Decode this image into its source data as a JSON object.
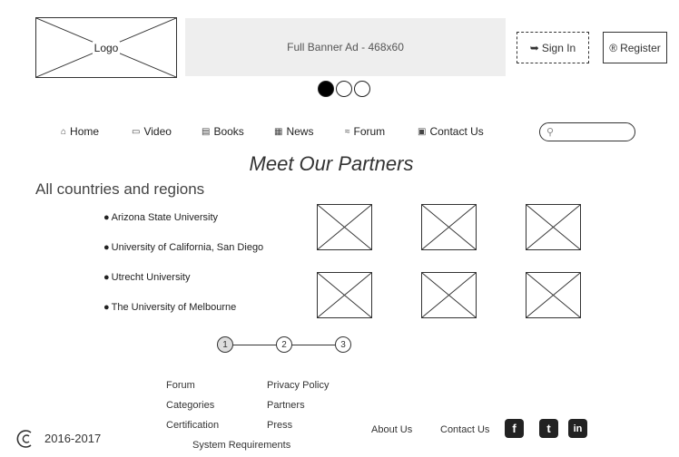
{
  "header": {
    "logo_label": "Logo",
    "banner_text": "Full Banner Ad - 468x60",
    "signin_label": "Sign In",
    "register_label": "Register"
  },
  "carousel": {
    "active_index": 1,
    "count": 3
  },
  "nav": {
    "items": [
      {
        "label": "Home",
        "icon": "home-icon"
      },
      {
        "label": "Video",
        "icon": "video-icon"
      },
      {
        "label": "Books",
        "icon": "book-icon"
      },
      {
        "label": "News",
        "icon": "news-icon"
      },
      {
        "label": "Forum",
        "icon": "forum-icon"
      },
      {
        "label": "Contact Us",
        "icon": "contact-card-icon"
      }
    ],
    "search_placeholder": ""
  },
  "main": {
    "title": "Meet Our Partners",
    "subtitle": "All countries and regions",
    "universities": [
      "Arizona State University",
      "University of California, San Diego",
      "Utrecht University",
      "The University of Melbourne"
    ]
  },
  "pagination": {
    "pages": [
      "1",
      "2",
      "3"
    ],
    "current": "1"
  },
  "footer": {
    "col1": [
      "Forum",
      "Categories",
      "Certification"
    ],
    "col2": [
      "Privacy Policy",
      "Partners",
      "Press"
    ],
    "system_requirements": "System Requirements",
    "about_us": "About Us",
    "contact_us": "Contact Us",
    "copyright_years": "2016-2017",
    "social": [
      {
        "name": "facebook-icon",
        "glyph": "f"
      },
      {
        "name": "twitter-icon",
        "glyph": "t"
      },
      {
        "name": "linkedin-icon",
        "glyph": "in"
      }
    ]
  }
}
